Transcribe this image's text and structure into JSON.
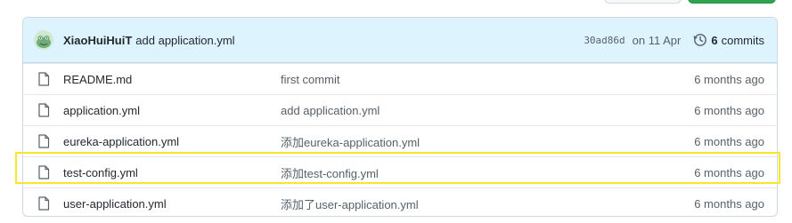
{
  "latest_commit": {
    "author": "XiaoHuiHuiT",
    "message": "add application.yml",
    "sha": "30ad86d",
    "date": "on 11 Apr",
    "commits_count": "6",
    "commits_label": "commits"
  },
  "files": [
    {
      "name": "README.md",
      "message": "first commit",
      "age": "6 months ago"
    },
    {
      "name": "application.yml",
      "message": "add application.yml",
      "age": "6 months ago"
    },
    {
      "name": "eureka-application.yml",
      "message": "添加eureka-application.yml",
      "age": "6 months ago"
    },
    {
      "name": "test-config.yml",
      "message": "添加test-config.yml",
      "age": "6 months ago",
      "highlighted": true
    },
    {
      "name": "user-application.yml",
      "message": "添加了user-application.yml",
      "age": "6 months ago"
    }
  ],
  "highlight_color": "#f5e72a",
  "icons": {
    "file": "file-icon",
    "history": "history-icon",
    "avatar": "avatar"
  }
}
